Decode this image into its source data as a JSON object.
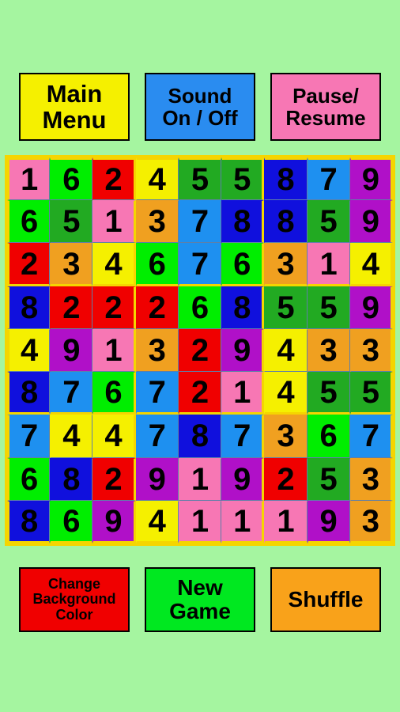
{
  "app": {
    "background_color": "#a5f5a0"
  },
  "top_buttons": [
    {
      "name": "main-menu",
      "label": "Main\nMenu",
      "color": "#f5f000"
    },
    {
      "name": "sound",
      "label": "Sound\nOn / Off",
      "color": "#2a8cf0"
    },
    {
      "name": "pause",
      "label": "Pause/\nResume",
      "color": "#f777b4"
    }
  ],
  "bottom_buttons": [
    {
      "name": "change-background-color",
      "label": "Change\nBackground\nColor",
      "color": "#f00000"
    },
    {
      "name": "new-game",
      "label": "New\nGame",
      "color": "#00e820"
    },
    {
      "name": "shuffle",
      "label": "Shuffle",
      "color": "#f9a21a"
    }
  ],
  "grid": {
    "rows": 9,
    "cols": 9,
    "border_color": "#f5d500",
    "cell_line_color": "#5f7fa8",
    "digit_color": "#000000",
    "palette": {
      "1": "#f777b4",
      "2": "#f00000",
      "3": "#f0a020",
      "4": "#f5f000",
      "5": "#22aa22",
      "6": "#00ee00",
      "7": "#1e90f0",
      "8": "#1010dd",
      "9": "#b010c8"
    },
    "values": [
      [
        1,
        6,
        2,
        4,
        5,
        5,
        8,
        7,
        9
      ],
      [
        6,
        5,
        1,
        3,
        7,
        8,
        8,
        5,
        9
      ],
      [
        2,
        3,
        4,
        6,
        7,
        6,
        3,
        1,
        4
      ],
      [
        8,
        2,
        2,
        2,
        6,
        8,
        5,
        5,
        9
      ],
      [
        4,
        9,
        1,
        3,
        2,
        9,
        4,
        3,
        3
      ],
      [
        8,
        7,
        6,
        7,
        2,
        1,
        4,
        5,
        5
      ],
      [
        7,
        4,
        4,
        7,
        8,
        7,
        3,
        6,
        7
      ],
      [
        6,
        8,
        2,
        9,
        1,
        9,
        2,
        5,
        3
      ],
      [
        8,
        6,
        9,
        4,
        1,
        1,
        1,
        9,
        3
      ]
    ]
  }
}
